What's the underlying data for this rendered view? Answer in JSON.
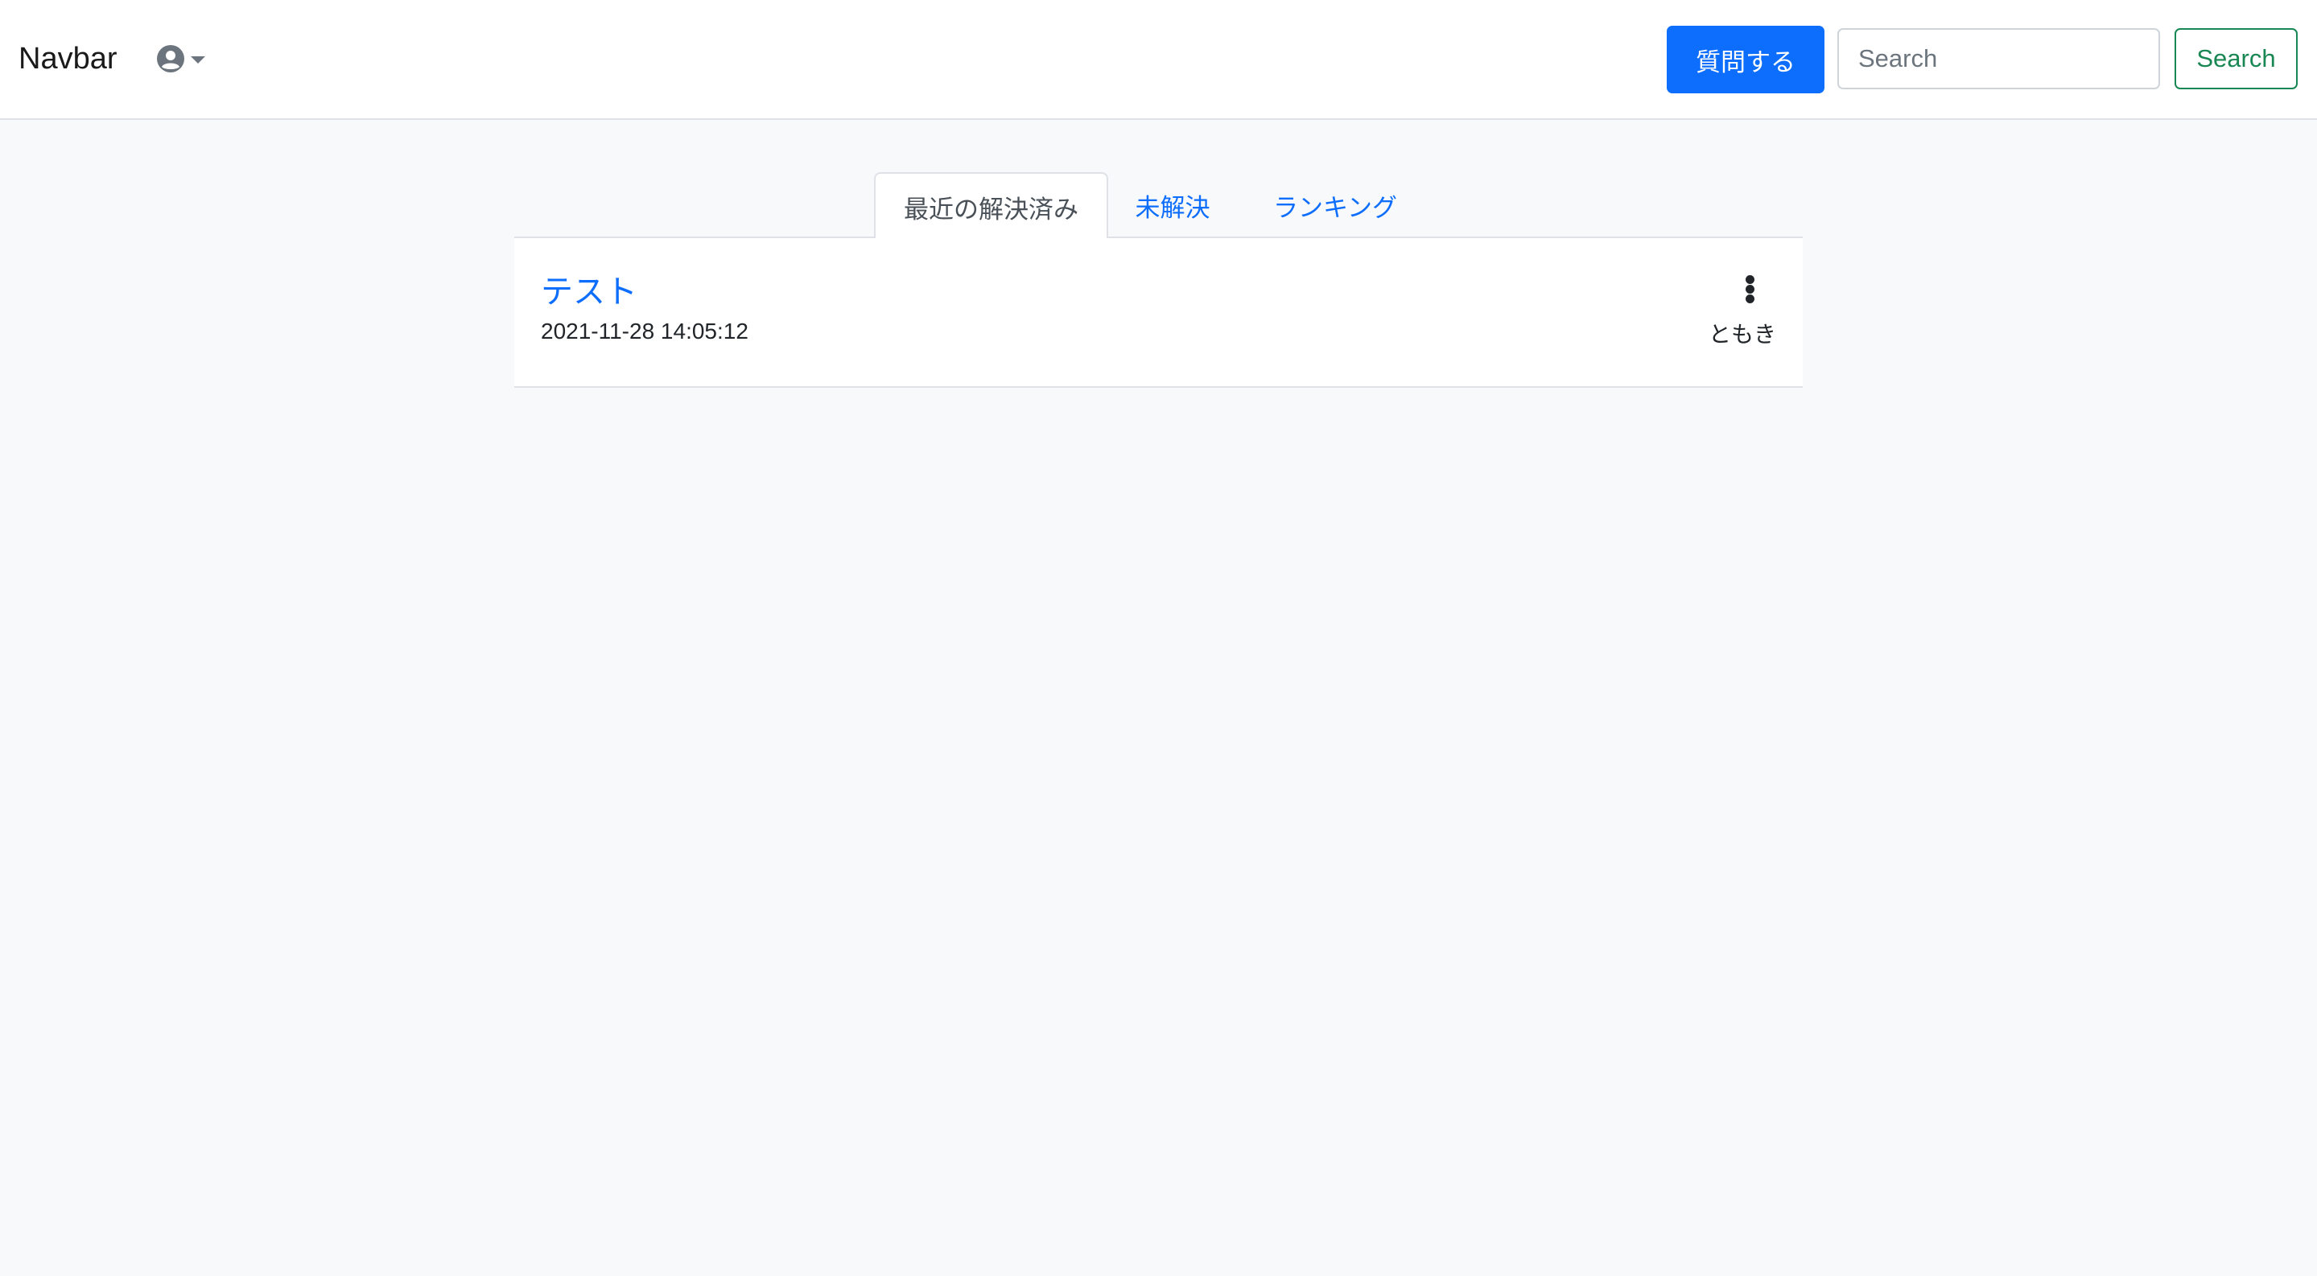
{
  "navbar": {
    "brand": "Navbar",
    "user_menu_icon": "user-circle-icon",
    "ask_button_label": "質問する",
    "search": {
      "placeholder": "Search",
      "value": ""
    },
    "search_button_label": "Search",
    "colors": {
      "primary": "#0d6efd",
      "success": "#198754"
    }
  },
  "tabs": [
    {
      "label": "最近の解決済み",
      "active": true
    },
    {
      "label": "未解決",
      "active": false
    },
    {
      "label": "ランキング",
      "active": false
    }
  ],
  "questions": [
    {
      "title": "テスト",
      "datetime": "2021-11-28 14:05:12",
      "author": "ともき",
      "menu_icon": "kebab-menu-icon"
    }
  ]
}
